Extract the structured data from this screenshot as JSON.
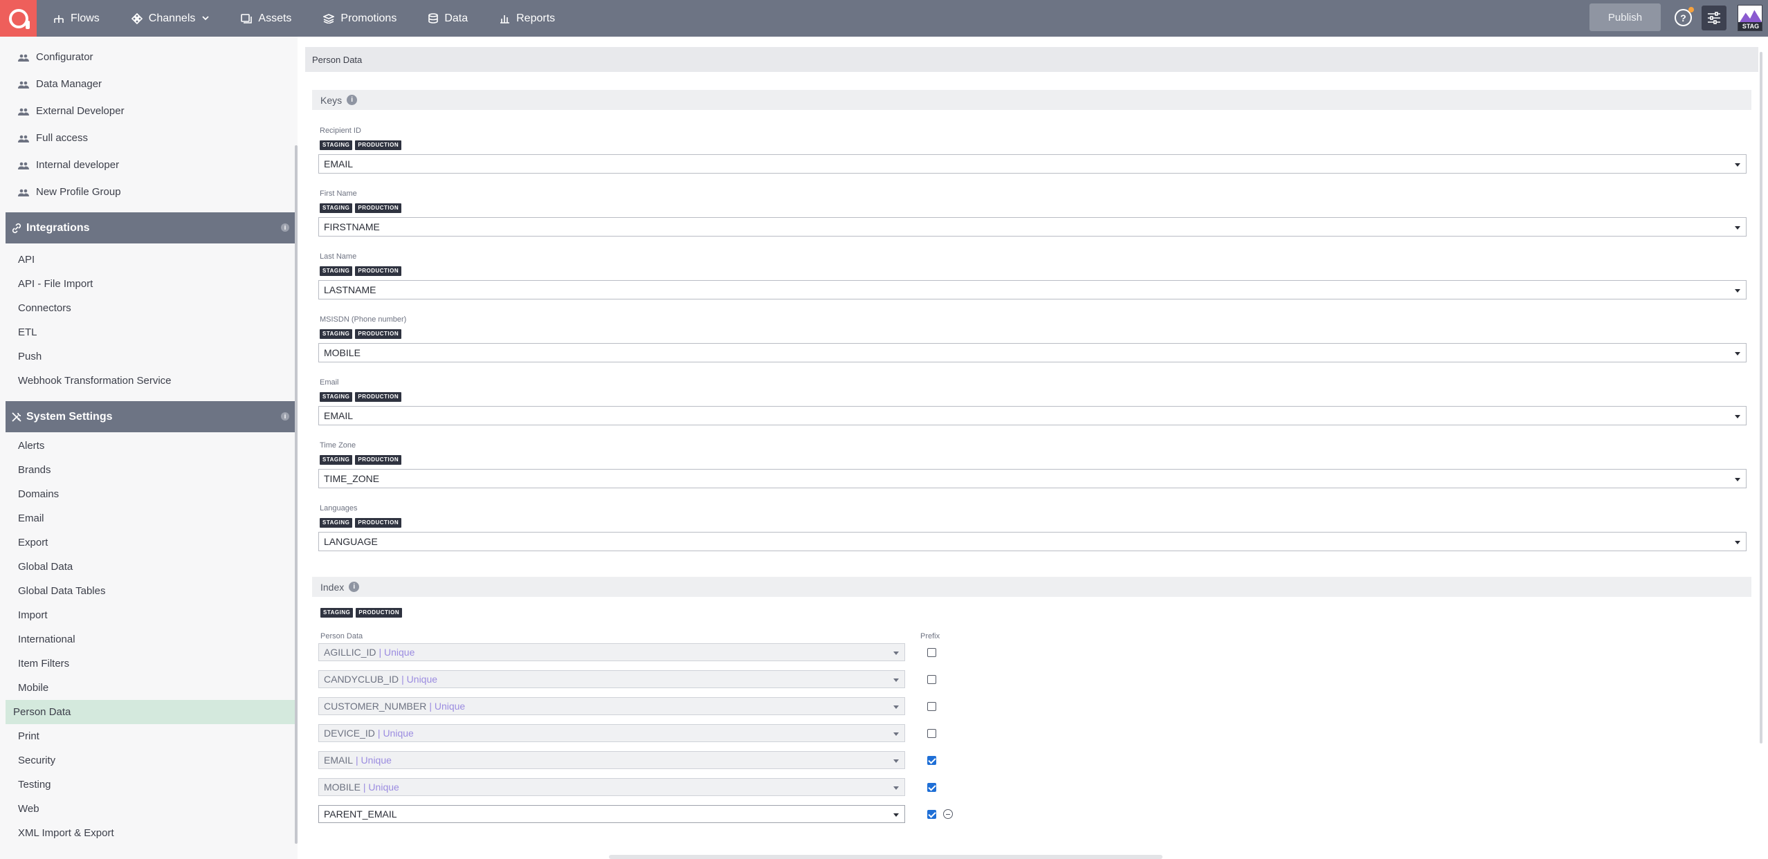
{
  "topbar": {
    "nav": [
      {
        "label": "Flows",
        "icon": "flows-icon"
      },
      {
        "label": "Channels",
        "icon": "channels-icon"
      },
      {
        "label": "Assets",
        "icon": "assets-icon"
      },
      {
        "label": "Promotions",
        "icon": "promotions-icon"
      },
      {
        "label": "Data",
        "icon": "data-icon"
      },
      {
        "label": "Reports",
        "icon": "reports-icon"
      }
    ],
    "publish_label": "Publish",
    "help_label": "?",
    "env_label": "STAG"
  },
  "sidebar": {
    "profile_groups": [
      "Configurator",
      "Data Manager",
      "External Developer",
      "Full access",
      "Internal developer",
      "New Profile Group"
    ],
    "integrations": {
      "title": "Integrations",
      "items": [
        "API",
        "API - File Import",
        "Connectors",
        "ETL",
        "Push",
        "Webhook Transformation Service"
      ]
    },
    "system_settings": {
      "title": "System Settings",
      "items": [
        "Alerts",
        "Brands",
        "Domains",
        "Email",
        "Export",
        "Global Data",
        "Global Data Tables",
        "Import",
        "International",
        "Item Filters",
        "Mobile",
        "Person Data",
        "Print",
        "Security",
        "Testing",
        "Web",
        "XML Import & Export"
      ],
      "active": "Person Data"
    },
    "info_glyph": "i"
  },
  "main": {
    "panel_title": "Person Data",
    "keys_title": "Keys",
    "tag_staging": "STAGING",
    "tag_production": "PRODUCTION",
    "keys": [
      {
        "label": "Recipient ID",
        "value": "EMAIL"
      },
      {
        "label": "First Name",
        "value": "FIRSTNAME"
      },
      {
        "label": "Last Name",
        "value": "LASTNAME"
      },
      {
        "label": "MSISDN (Phone number)",
        "value": "MOBILE"
      },
      {
        "label": "Email",
        "value": "EMAIL"
      },
      {
        "label": "Time Zone",
        "value": "TIME_ZONE"
      },
      {
        "label": "Languages",
        "value": "LANGUAGE"
      }
    ],
    "index": {
      "title": "Index",
      "col_person_data": "Person Data",
      "col_prefix": "Prefix",
      "unique_suffix": "| Unique",
      "rows": [
        {
          "field": "AGILLIC_ID",
          "unique": true,
          "prefix": false
        },
        {
          "field": "CANDYCLUB_ID",
          "unique": true,
          "prefix": false
        },
        {
          "field": "CUSTOMER_NUMBER",
          "unique": true,
          "prefix": false
        },
        {
          "field": "DEVICE_ID",
          "unique": true,
          "prefix": false
        },
        {
          "field": "EMAIL",
          "unique": true,
          "prefix": true
        },
        {
          "field": "MOBILE",
          "unique": true,
          "prefix": true
        },
        {
          "field": "PARENT_EMAIL",
          "unique": false,
          "prefix": true
        }
      ]
    }
  },
  "colors": {
    "topbar": "#6d7484",
    "logo": "#ee5f5b",
    "active_item": "#d4e9dd",
    "checkbox_on": "#1f6fd6",
    "unique_text": "#9b8ce0"
  }
}
